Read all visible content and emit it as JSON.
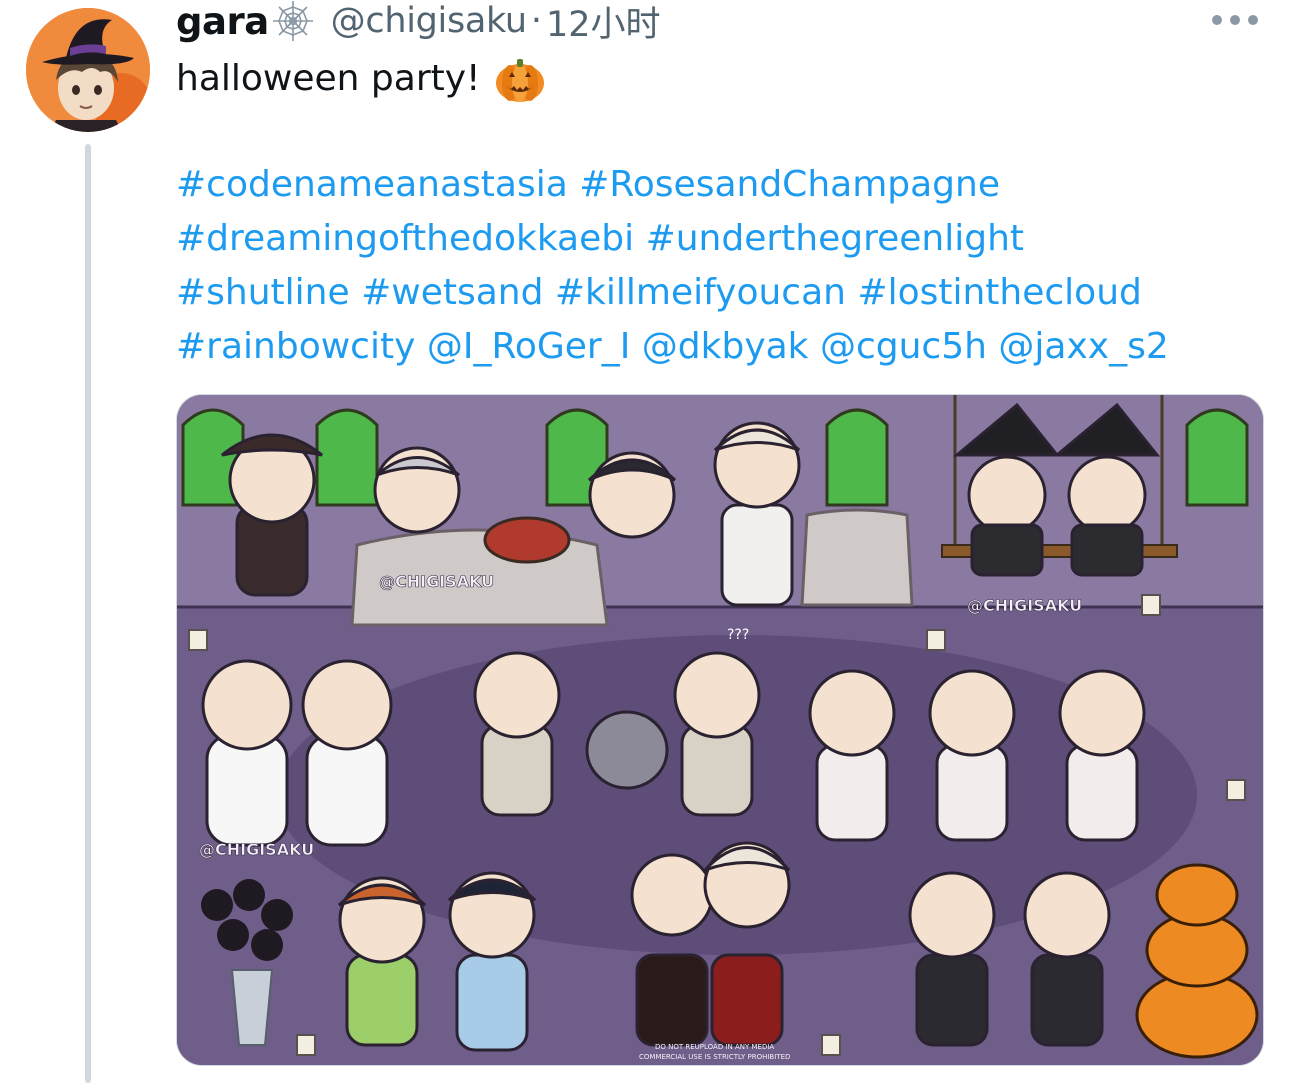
{
  "tweet": {
    "display_name": "gara",
    "handle": "@chigisaku",
    "separator": "·",
    "time": "12小时",
    "text": "halloween party!",
    "tags_line1": "#codenameanastasia #RosesandChampagne",
    "tags_line2": "#dreamingofthedokkaebi #underthegreenlight",
    "tags_line3": "#shutline #wetsand #killmeifyoucan #lostinthecloud",
    "tags_line4": "#rainbowcity @I_RoGer_I @dkbyak @cguc5h @jaxx_s2"
  },
  "media": {
    "watermark_1": "@CHIGISAKU",
    "watermark_2": "@CHIGISAKU",
    "watermark_3": "@CHIGISAKU",
    "notice_line1": "DO NOT REUPLOAD IN ANY MEDIA",
    "notice_line2": "COMMERCIAL USE IS STRICTLY PROHIBITED",
    "question_marks": "???"
  },
  "colors": {
    "link": "#1d9bf0",
    "text": "#0f1419",
    "muted": "#536471"
  },
  "icons": [
    "spiderweb-icon",
    "jack-o-lantern-emoji",
    "more-options-icon"
  ]
}
